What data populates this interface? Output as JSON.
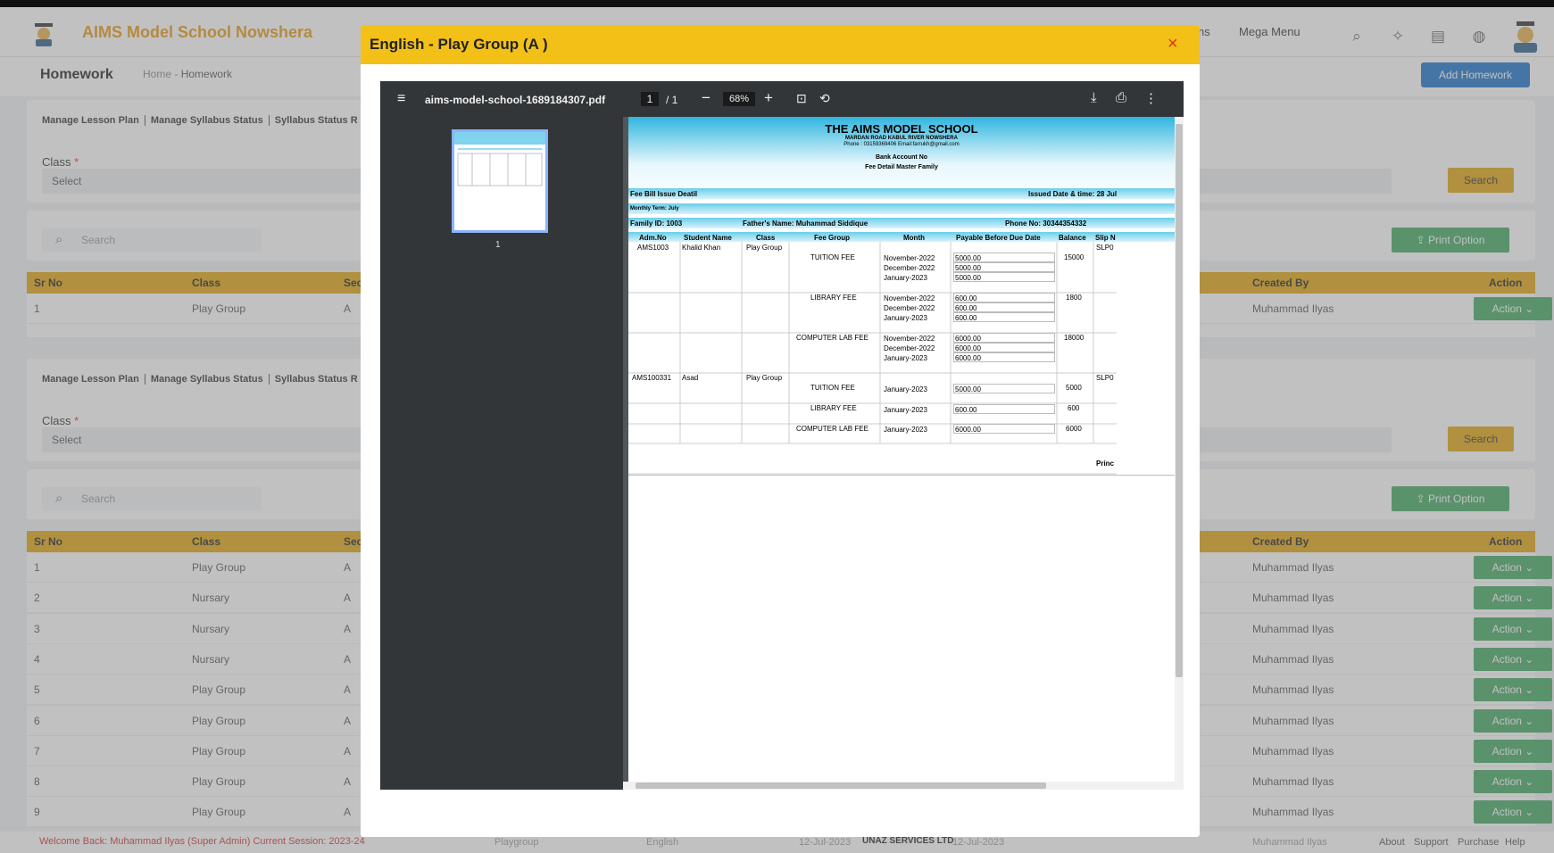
{
  "app": {
    "brand": "AIMS Model School Nowshera",
    "nav": [
      "ns",
      "Mega Menu"
    ],
    "page_title": "Homework",
    "breadcrumb_home": "Home",
    "breadcrumb_sep": "-",
    "breadcrumb_current": "Homework",
    "add_button": "Add Homework"
  },
  "tabs": [
    "Manage Lesson Plan",
    "Manage Syllabus Status",
    "Syllabus Status R"
  ],
  "filter": {
    "class_label": "Class",
    "required": "*",
    "select_value": "Select",
    "search_button": "Search"
  },
  "toolbar": {
    "search_placeholder": "Search",
    "print_label": "Print Option"
  },
  "table": {
    "columns": [
      "Sr No",
      "Class",
      "Sec",
      "Created By",
      "Action"
    ],
    "rows_top": [
      {
        "sr": "1",
        "cls": "Play Group",
        "sec": "A",
        "by": "Muhammad Ilyas"
      }
    ],
    "rows": [
      {
        "sr": "1",
        "cls": "Play Group",
        "sec": "A",
        "by": "Muhammad Ilyas"
      },
      {
        "sr": "2",
        "cls": "Nursary",
        "sec": "A",
        "by": "Muhammad Ilyas"
      },
      {
        "sr": "3",
        "cls": "Nursary",
        "sec": "A",
        "by": "Muhammad Ilyas"
      },
      {
        "sr": "4",
        "cls": "Nursary",
        "sec": "A",
        "by": "Muhammad Ilyas"
      },
      {
        "sr": "5",
        "cls": "Play Group",
        "sec": "A",
        "by": "Muhammad Ilyas"
      },
      {
        "sr": "6",
        "cls": "Play Group",
        "sec": "A",
        "by": "Muhammad Ilyas"
      },
      {
        "sr": "7",
        "cls": "Play Group",
        "sec": "A",
        "by": "Muhammad Ilyas"
      },
      {
        "sr": "8",
        "cls": "Play Group",
        "sec": "A",
        "by": "Muhammad Ilyas"
      },
      {
        "sr": "9",
        "cls": "Play Group",
        "sec": "A",
        "by": "Muhammad Ilyas"
      }
    ],
    "action_label": "Action ⌄"
  },
  "footer": {
    "welcome": "Welcome Back: Muhammad Ilyas (Super Admin)  Current Session: 2023-24",
    "c1": "Playgroup",
    "c2": "English",
    "c3": "12-Jul-2023",
    "company": "UNAZ SERVICES LTD",
    "c4": "12-Jul-2023",
    "c5": "Muhammad Ilyas",
    "links": [
      "About",
      "Support",
      "Purchase",
      "Help"
    ]
  },
  "modal": {
    "title": "English - Play Group (A )",
    "close": "×"
  },
  "viewer": {
    "file": "aims-model-school-1689184307.pdf",
    "page": "1",
    "of": "/ 1",
    "zoom": "68%",
    "thumb_label": "1"
  },
  "doc": {
    "school": "THE AIMS MODEL SCHOOL",
    "address": "MARDAN ROAD KABUL RIVER NOWSHERA",
    "contact": "Phone : 03159369406   Email:farrukh@gmail.com",
    "bank": "Bank Account No",
    "subtitle": "Fee Detail Master Family",
    "bill_title": "Fee Bill Issue Deatil",
    "issued": "Issued Date & time: 28 Jul",
    "term": "Monthly Term: July",
    "family": "Family ID: 1003",
    "father": "Father's Name: Muhammad Siddique",
    "phone": "Phone No: 30344354332",
    "cols": [
      "Adm.No",
      "Student Name",
      "Class",
      "Fee Group",
      "Month",
      "Payable Before Due Date",
      "Balance",
      "Slip N"
    ],
    "s1": {
      "adm": "AMS1003",
      "name": "Khalid Khan",
      "cls": "Play Group",
      "slip": "SLP0"
    },
    "s2": {
      "adm": "AMS100331",
      "name": "Asad",
      "cls": "Play Group",
      "slip": "SLP0"
    },
    "g1": {
      "group": "TUITION FEE",
      "balance": "15000",
      "months": [
        "November-2022",
        "December-2022",
        "January-2023"
      ],
      "amounts": [
        "5000.00",
        "5000.00",
        "5000.00"
      ]
    },
    "g2": {
      "group": "LIBRARY FEE",
      "balance": "1800",
      "months": [
        "November-2022",
        "December-2022",
        "January-2023"
      ],
      "amounts": [
        "600.00",
        "600.00",
        "600.00"
      ]
    },
    "g3": {
      "group": "COMPUTER LAB FEE",
      "balance": "18000",
      "months": [
        "November-2022",
        "December-2022",
        "January-2023"
      ],
      "amounts": [
        "6000.00",
        "6000.00",
        "6000.00"
      ]
    },
    "g4": {
      "group": "TUITION FEE",
      "balance": "5000",
      "month": "January-2023",
      "amount": "5000.00"
    },
    "g5": {
      "group": "LIBRARY FEE",
      "balance": "600",
      "month": "January-2023",
      "amount": "600.00"
    },
    "g6": {
      "group": "COMPUTER LAB FEE",
      "balance": "6000",
      "month": "January-2023",
      "amount": "6000.00"
    },
    "sign": "Princ"
  }
}
